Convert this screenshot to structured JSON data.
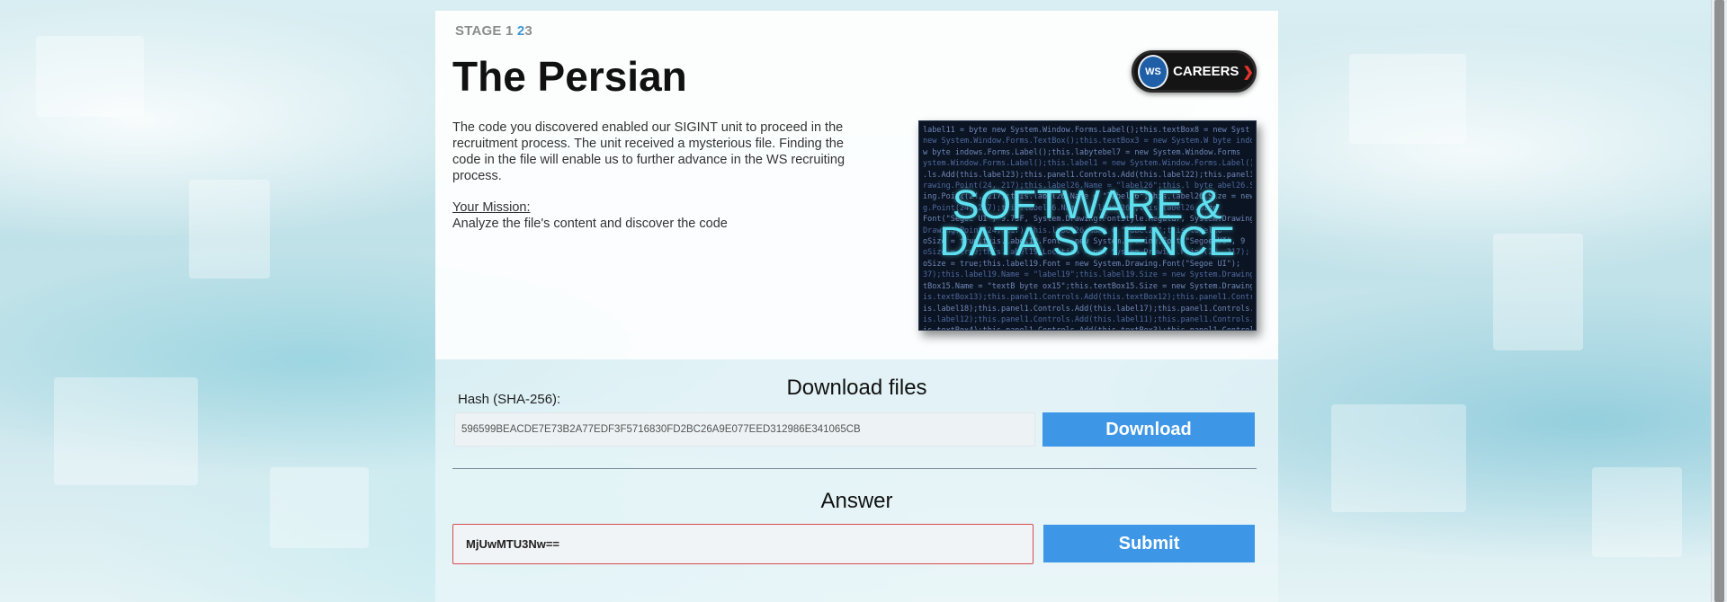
{
  "stage": {
    "label": "STAGE",
    "steps": [
      "1",
      "2",
      "3"
    ],
    "current": "2"
  },
  "page_title": "The Persian",
  "careers_button": {
    "label": "CAREERS",
    "arrow": "❯",
    "logo_text": "WS"
  },
  "description": "The code you discovered enabled our SIGINT unit to proceed in the recruitment process. The unit received a mysterious file. Finding the code in the file will enable us to further advance in the WS recruiting process.",
  "mission": {
    "label": "Your Mission:",
    "text": "Analyze the file's content and discover the code"
  },
  "banner": {
    "line1": "SOFTWARE &",
    "line2": "DATA SCIENCE",
    "code_lines": [
      "label11 = byte new System.Window.Forms.Label();this.textBox8 = new Syst",
      "new System.Window.Forms.TextBox();this.textBox3 = new System.W byte indow",
      "w byte indows.Forms.Label();this.labytebel7 = new System.Window.Forms",
      "ystem.Window.Forms.Label();this.label1 = new System.Window.Forms.Label();this",
      ".ls.Add(this.label23);this.panel1.Controls.Add(this.label22);this.panel1",
      "rawing.Point(24, 217);this.label26.Name = \"label26\";this.l byte abel26.Siz",
      "ing.Point(24, 217);this.label26.Name = \"label26\";this.label26.Size = new",
      "g.Point(24, 217);this.label26.Name = \"label26\";this.label26.Size",
      "Font(\"Segoe UI\", 9.75F, System.Drawing.FontStyle.Regular, System.Drawing",
      "Drawing.Point(24, 217);this.label26.Name = \"label26\";this.label26",
      "oSize = true;this.label19.Font = new System.Drawing.Font(\"Segoe UI\", 9",
      "oSize = true;this.label19.Location = new System.Drawing.Point(24, 217);",
      "oSize = true;this.label19.Font = new System.Drawing.Font(\"Segoe UI\");",
      " 37);this.label19.Name = \"label19\";this.label19.Size = new System.Drawing",
      "tBox15.Name = \"textB byte ox15\";this.textBox15.Size = new System.Drawing",
      "is.textBox13);this.panel1.Controls.Add(this.textBox12);this.panel1.Contr",
      "is.label18);this.panel1.Controls.Add(this.label17);this.panel1.Controls.A",
      "is.label12);this.panel1.Controls.Add(this.label11);this.panel1.Controls.Add",
      "is.textBox4);this.panel1.Controls.Add(this.textBox3);this.panel1.Controls"
    ]
  },
  "download": {
    "section_title": "Download files",
    "hash_label": "Hash (SHA-256):",
    "hash_value": "596599BEACDE7E73B2A77EDF3F5716830FD2BC26A9E077EED312986E341065CB",
    "button_label": "Download"
  },
  "answer": {
    "section_title": "Answer",
    "input_value": "MjUwMTU3Nw==",
    "button_label": "Submit"
  },
  "colors": {
    "accent_blue": "#3d97e6",
    "stage_active": "#3d97d6",
    "error_border": "#d84b4b",
    "banner_text": "#5ee0f0"
  }
}
